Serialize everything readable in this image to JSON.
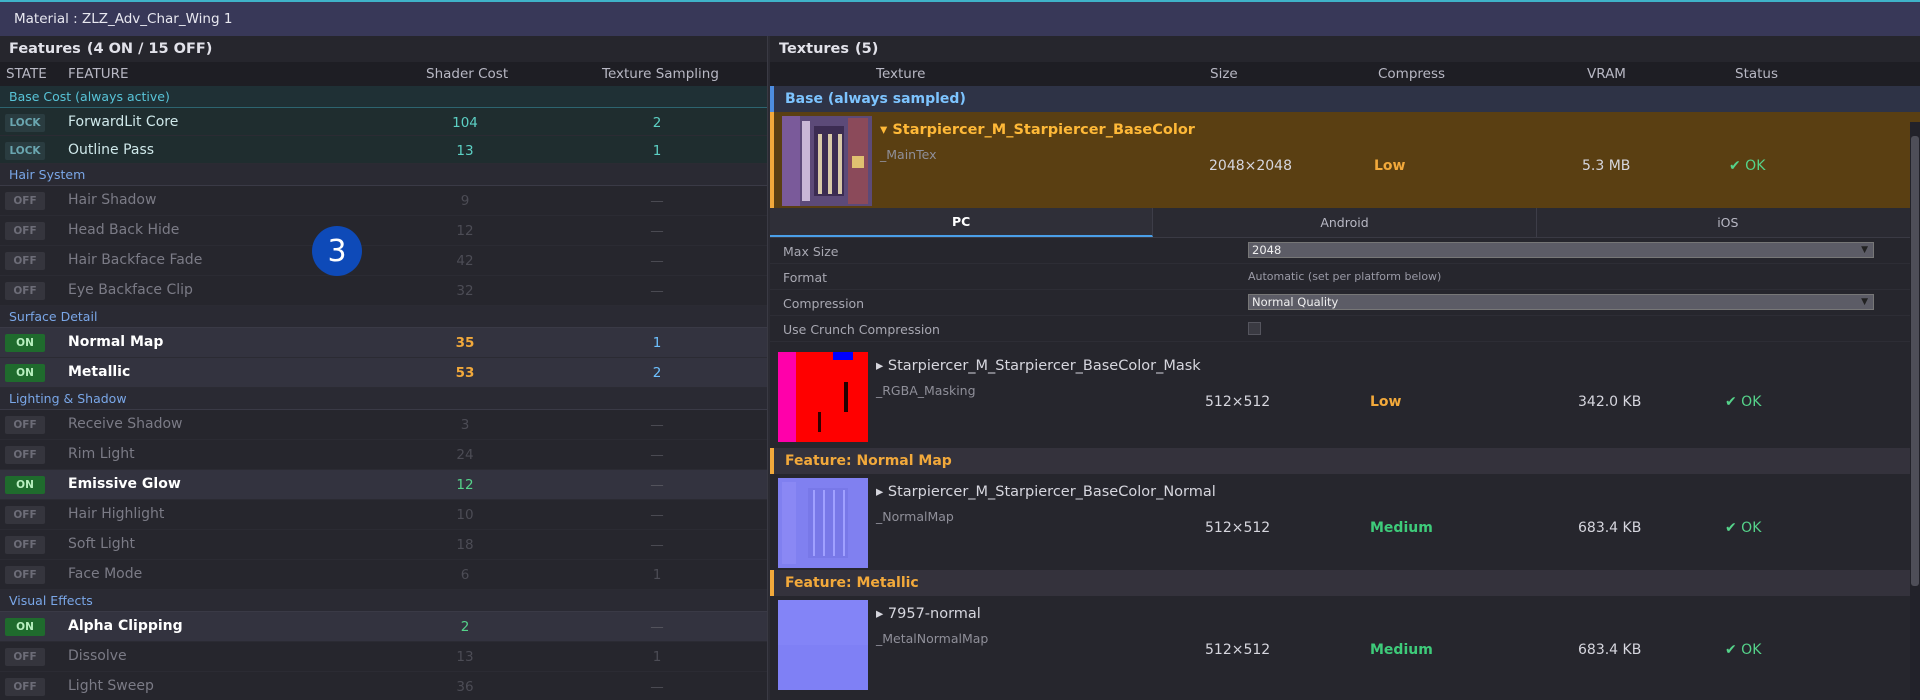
{
  "title": "Material : ZLZ_Adv_Char_Wing 1",
  "features": {
    "title": "Features",
    "count_text": "(4 ON / 15 OFF)",
    "headers": {
      "state": "STATE",
      "feature": "FEATURE",
      "shader_cost": "Shader Cost",
      "texture_sampling": "Texture Sampling"
    },
    "groups": [
      {
        "label": "Base Cost  (always active)",
        "kind": "base",
        "rows": [
          {
            "state": "LOCK",
            "kind": "lock",
            "name": "ForwardLit Core",
            "cost": "104",
            "sampling": "2"
          },
          {
            "state": "LOCK",
            "kind": "lock",
            "name": "Outline Pass",
            "cost": "13",
            "sampling": "1"
          }
        ]
      },
      {
        "label": "Hair System",
        "kind": "cat",
        "rows": [
          {
            "state": "OFF",
            "kind": "off",
            "name": "Hair Shadow",
            "cost": "9",
            "sampling": "—"
          },
          {
            "state": "OFF",
            "kind": "off",
            "name": "Head Back Hide",
            "cost": "12",
            "sampling": "—"
          },
          {
            "state": "OFF",
            "kind": "off",
            "name": "Hair Backface Fade",
            "cost": "42",
            "sampling": "—"
          },
          {
            "state": "OFF",
            "kind": "off",
            "name": "Eye Backface Clip",
            "cost": "32",
            "sampling": "—"
          }
        ]
      },
      {
        "label": "Surface Detail",
        "kind": "cat",
        "rows": [
          {
            "state": "ON",
            "kind": "on",
            "name": "Normal Map",
            "cost": "35",
            "sampling": "1",
            "cost_color": "orange"
          },
          {
            "state": "ON",
            "kind": "on",
            "name": "Metallic",
            "cost": "53",
            "sampling": "2",
            "cost_color": "orange"
          }
        ]
      },
      {
        "label": "Lighting & Shadow",
        "kind": "cat",
        "rows": [
          {
            "state": "OFF",
            "kind": "off",
            "name": "Receive Shadow",
            "cost": "3",
            "sampling": "—"
          },
          {
            "state": "OFF",
            "kind": "off",
            "name": "Rim Light",
            "cost": "24",
            "sampling": "—"
          },
          {
            "state": "ON",
            "kind": "on",
            "name": "Emissive Glow",
            "cost": "12",
            "sampling": "—",
            "cost_color": "green"
          },
          {
            "state": "OFF",
            "kind": "off",
            "name": "Hair Highlight",
            "cost": "10",
            "sampling": "—"
          },
          {
            "state": "OFF",
            "kind": "off",
            "name": "Soft Light",
            "cost": "18",
            "sampling": "—"
          },
          {
            "state": "OFF",
            "kind": "off",
            "name": "Face Mode",
            "cost": "6",
            "sampling": "1"
          }
        ]
      },
      {
        "label": "Visual Effects",
        "kind": "cat",
        "rows": [
          {
            "state": "ON",
            "kind": "on",
            "name": "Alpha Clipping",
            "cost": "2",
            "sampling": "—",
            "cost_color": "green"
          },
          {
            "state": "OFF",
            "kind": "off",
            "name": "Dissolve",
            "cost": "13",
            "sampling": "1"
          },
          {
            "state": "OFF",
            "kind": "off",
            "name": "Light Sweep",
            "cost": "36",
            "sampling": "—"
          }
        ]
      }
    ]
  },
  "marker": "3",
  "textures": {
    "title": "Textures",
    "count_text": "(5)",
    "headers": {
      "texture": "Texture",
      "size": "Size",
      "compress": "Compress",
      "vram": "VRAM",
      "status": "Status"
    },
    "base_section": "Base  (always sampled)",
    "selected": {
      "name": "▾ Starpiercer_M_Starpiercer_BaseColor",
      "property": "_MainTex",
      "size": "2048×2048",
      "compress": "Low",
      "vram": "5.3 MB",
      "status": "✔ OK"
    },
    "platform_tabs": [
      "PC",
      "Android",
      "iOS"
    ],
    "settings": {
      "max_size_label": "Max Size",
      "max_size_value": "2048",
      "format_label": "Format",
      "format_value": "Automatic  (set per platform below)",
      "compression_label": "Compression",
      "compression_value": "Normal Quality",
      "crunch_label": "Use Crunch Compression"
    },
    "mask": {
      "name": "▸ Starpiercer_M_Starpiercer_BaseColor_Mask",
      "property": "_RGBA_Masking",
      "size": "512×512",
      "compress": "Low",
      "vram": "342.0 KB",
      "status": "✔ OK"
    },
    "normal_section": "Feature: Normal Map",
    "normal": {
      "name": "▸ Starpiercer_M_Starpiercer_BaseColor_Normal",
      "property": "_NormalMap",
      "size": "512×512",
      "compress": "Medium",
      "vram": "683.4 KB",
      "status": "✔ OK"
    },
    "metallic_section": "Feature: Metallic",
    "metallic": {
      "name": "▸ 7957-normal",
      "property": "_MetalNormalMap",
      "size": "512×512",
      "compress": "Medium",
      "vram": "683.4 KB",
      "status": "✔ OK"
    }
  }
}
